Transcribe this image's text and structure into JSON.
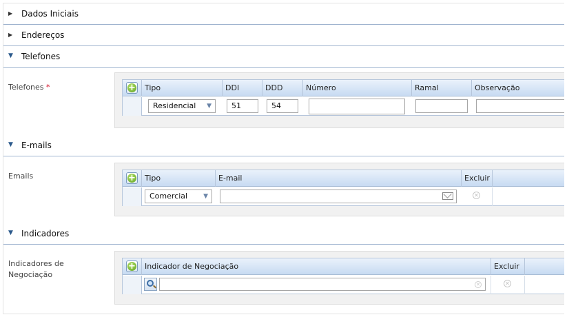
{
  "sections": {
    "dados_iniciais": "Dados Iniciais",
    "enderecos": "Endereços",
    "telefones": "Telefones",
    "emails": "E-mails",
    "indicadores": "Indicadores"
  },
  "telefones": {
    "field_label": "Telefones",
    "required_mark": "*",
    "columns": [
      "Tipo",
      "DDI",
      "DDD",
      "Número",
      "Ramal",
      "Observação"
    ],
    "row": {
      "tipo": "Residencial",
      "ddi": "51",
      "ddd": "54",
      "numero": "",
      "ramal": "",
      "observacao": ""
    }
  },
  "emails": {
    "field_label": "Emails",
    "columns": [
      "Tipo",
      "E-mail",
      "Excluir"
    ],
    "row": {
      "tipo": "Comercial",
      "email": ""
    }
  },
  "indicadores": {
    "field_label_line1": "Indicadores de",
    "field_label_line2": "Negociação",
    "columns": [
      "Indicador de Negociação",
      "Excluir"
    ],
    "row": {
      "indicador": ""
    }
  },
  "icons": {
    "add": "plus-circle-icon",
    "expand": "triangle-right-icon",
    "collapse": "triangle-down-icon",
    "mail": "envelope-icon",
    "delete": "close-circle-icon",
    "search": "magnifier-icon"
  },
  "colors": {
    "header_gradient_top": "#eaf2fb",
    "header_gradient_bottom": "#c7dbf2",
    "section_rule": "#9fb4cf",
    "required": "#d0021b",
    "add_green": "#5aa01e"
  }
}
